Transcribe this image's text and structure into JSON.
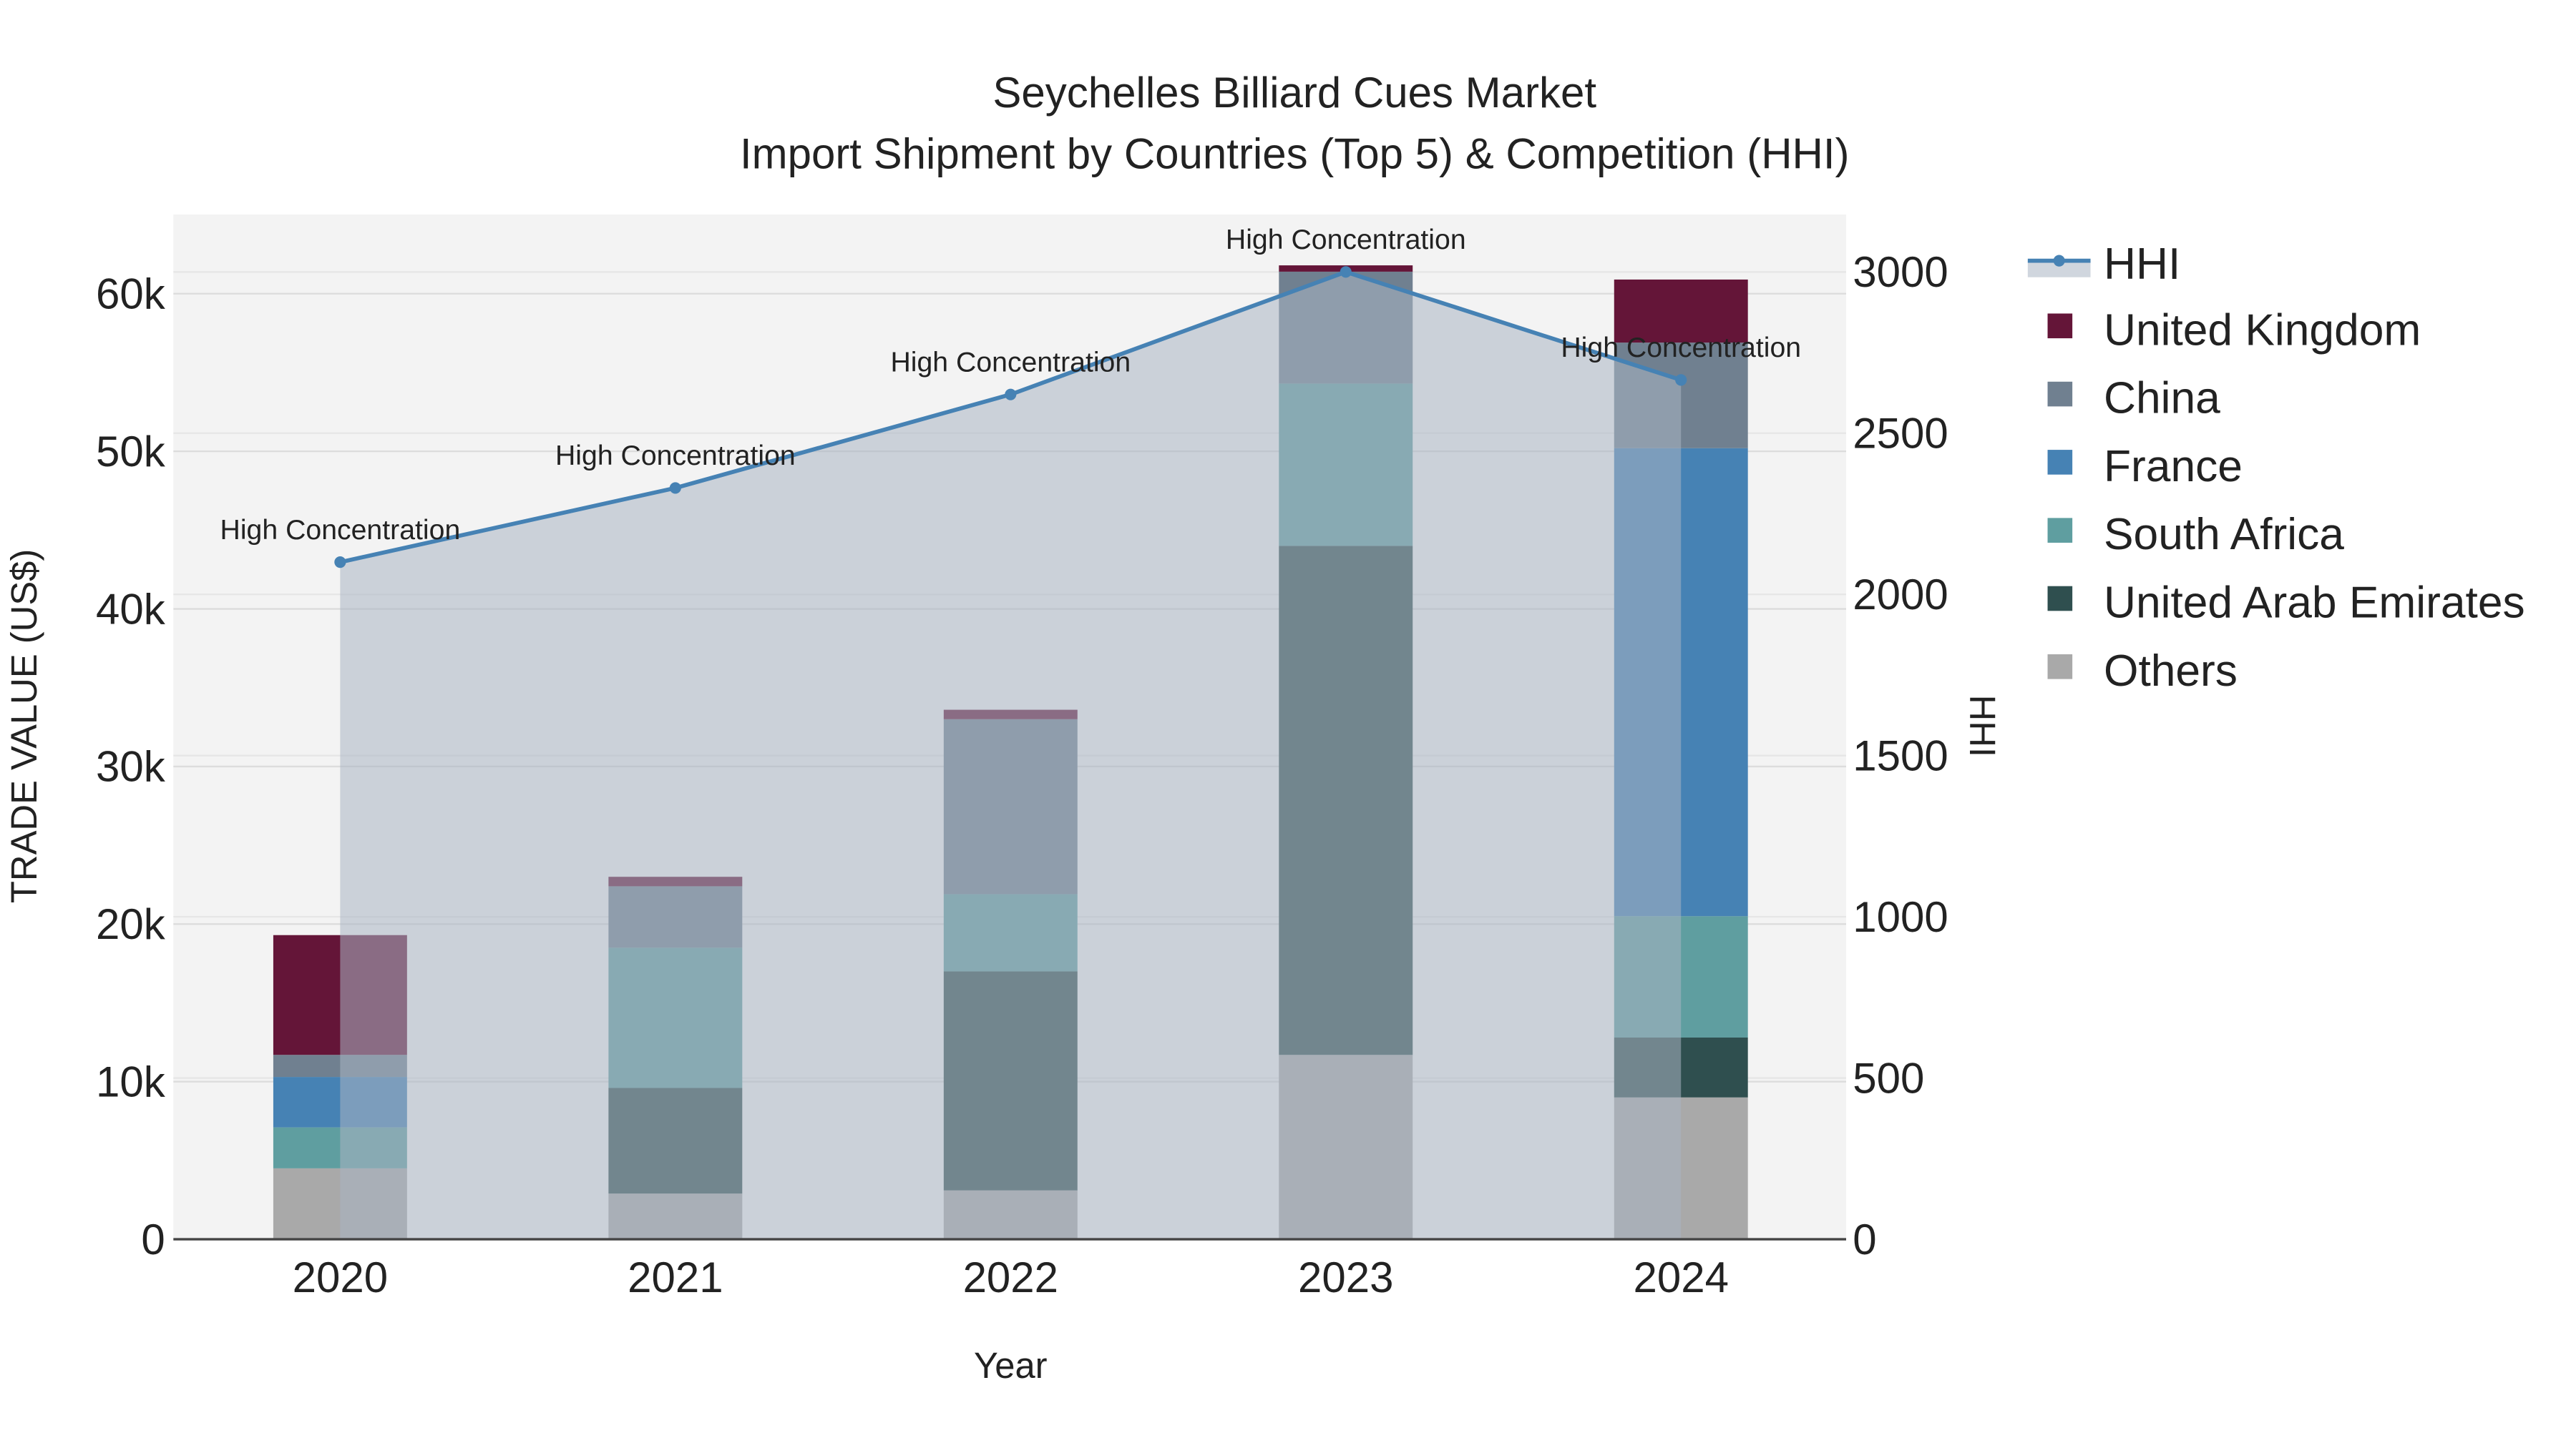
{
  "chart_data": {
    "type": "bar",
    "stacked": true,
    "title": "Seychelles Billiard Cues Market",
    "subtitle": "Import Shipment by Countries (Top 5) & Competition (HHI)",
    "xlabel": "Year",
    "ylabel": "TRADE VALUE (US$)",
    "y2label": "HHI",
    "categories": [
      "2020",
      "2021",
      "2022",
      "2023",
      "2024"
    ],
    "ylim": [
      0,
      65000
    ],
    "y_ticks": [
      0,
      10000,
      20000,
      30000,
      40000,
      50000,
      60000
    ],
    "y_tick_labels": [
      "0",
      "10k",
      "20k",
      "30k",
      "40k",
      "50k",
      "60k"
    ],
    "y2lim": [
      0,
      3170
    ],
    "y2_ticks": [
      0,
      500,
      1000,
      1500,
      2000,
      2500,
      3000
    ],
    "y2_tick_labels": [
      "0",
      "500",
      "1000",
      "1500",
      "2000",
      "2500",
      "3000"
    ],
    "grid": true,
    "legend_position": "right",
    "series": [
      {
        "name": "Others",
        "color": "#a9a9a9",
        "values": [
          4500,
          2900,
          3100,
          11700,
          9000
        ]
      },
      {
        "name": "United Arab Emirates",
        "color": "#2f4f4f",
        "values": [
          0,
          6700,
          13900,
          32300,
          3800
        ]
      },
      {
        "name": "South Africa",
        "color": "#5f9ea0",
        "values": [
          2600,
          8900,
          4900,
          10300,
          7700
        ]
      },
      {
        "name": "France",
        "color": "#4682b4",
        "values": [
          3200,
          0,
          0,
          0,
          29700
        ]
      },
      {
        "name": "China",
        "color": "#708090",
        "values": [
          1400,
          3900,
          11100,
          7100,
          6700
        ]
      },
      {
        "name": "United Kingdom",
        "color": "#641538",
        "values": [
          7600,
          600,
          600,
          400,
          4000
        ]
      }
    ],
    "line": {
      "name": "HHI",
      "color": "#4682b4",
      "values": [
        2100,
        2330,
        2620,
        3000,
        2665
      ],
      "annotations": [
        "High Concentration",
        "High Concentration",
        "High Concentration",
        "High Concentration",
        "High Concentration"
      ]
    },
    "legend_order": [
      "HHI",
      "United Kingdom",
      "China",
      "France",
      "South Africa",
      "United Arab Emirates",
      "Others"
    ]
  }
}
